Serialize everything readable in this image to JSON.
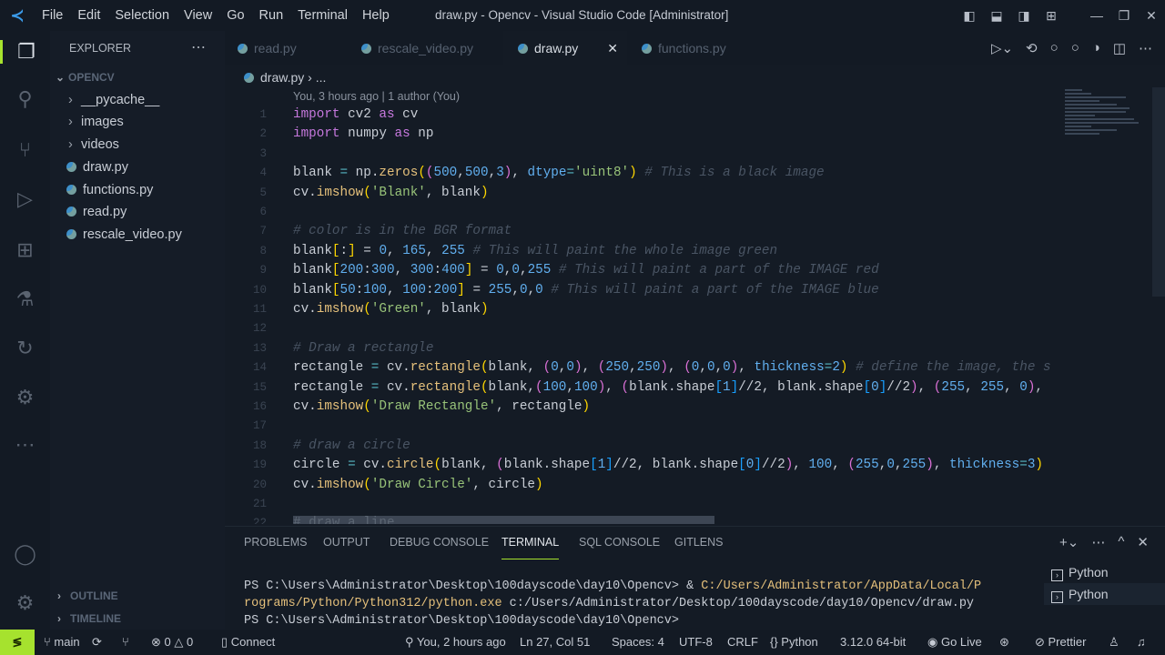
{
  "title_bar": {
    "menu": [
      "File",
      "Edit",
      "Selection",
      "View",
      "Go",
      "Run",
      "Terminal",
      "Help"
    ],
    "title": "draw.py - Opencv - Visual Studio Code [Administrator]"
  },
  "sidebar": {
    "title": "EXPLORER",
    "root": "OPENCV",
    "items": [
      {
        "label": "__pycache__",
        "type": "folder"
      },
      {
        "label": "images",
        "type": "folder"
      },
      {
        "label": "videos",
        "type": "folder"
      },
      {
        "label": "draw.py",
        "type": "file"
      },
      {
        "label": "functions.py",
        "type": "file"
      },
      {
        "label": "read.py",
        "type": "file"
      },
      {
        "label": "rescale_video.py",
        "type": "file"
      }
    ],
    "outline": "OUTLINE",
    "timeline": "TIMELINE"
  },
  "tabs": [
    {
      "label": "read.py"
    },
    {
      "label": "rescale_video.py"
    },
    {
      "label": "draw.py",
      "active": true
    },
    {
      "label": "functions.py"
    }
  ],
  "breadcrumb": {
    "file": "draw.py",
    "rest": "..."
  },
  "blame": "You, 3 hours ago | 1 author (You)",
  "code": [
    {
      "n": "1",
      "t": [
        [
          "import",
          "kw"
        ],
        [
          " cv2 ",
          ""
        ],
        [
          "as",
          "kw"
        ],
        [
          " cv",
          ""
        ]
      ]
    },
    {
      "n": "2",
      "t": [
        [
          "import",
          "kw"
        ],
        [
          " numpy ",
          ""
        ],
        [
          "as",
          "kw"
        ],
        [
          " np",
          ""
        ]
      ]
    },
    {
      "n": "3",
      "t": []
    },
    {
      "n": "4",
      "t": [
        [
          "blank ",
          ""
        ],
        [
          "=",
          "op"
        ],
        [
          " np.",
          ""
        ],
        [
          "zeros",
          "fn"
        ],
        [
          "(",
          "b1"
        ],
        [
          "(",
          "b2"
        ],
        [
          "500",
          "num"
        ],
        [
          ",",
          ""
        ],
        [
          "500",
          "num"
        ],
        [
          ",",
          ""
        ],
        [
          "3",
          "num"
        ],
        [
          ")",
          "b2"
        ],
        [
          ", ",
          ""
        ],
        [
          "dtype",
          "param"
        ],
        [
          "=",
          "op"
        ],
        [
          "'uint8'",
          "str"
        ],
        [
          ")",
          "b1"
        ],
        [
          " # This is a black image",
          "cm"
        ]
      ]
    },
    {
      "n": "5",
      "t": [
        [
          "cv.",
          ""
        ],
        [
          "imshow",
          "fn"
        ],
        [
          "(",
          "b1"
        ],
        [
          "'Blank'",
          "str"
        ],
        [
          ", blank",
          ""
        ],
        [
          ")",
          "b1"
        ]
      ]
    },
    {
      "n": "6",
      "t": []
    },
    {
      "n": "7",
      "t": [
        [
          "# color is in the BGR format",
          "cm"
        ]
      ]
    },
    {
      "n": "8",
      "t": [
        [
          "blank",
          ""
        ],
        [
          "[",
          "b1"
        ],
        [
          ":",
          ""
        ],
        [
          "]",
          "b1"
        ],
        [
          " = ",
          ""
        ],
        [
          "0",
          "num"
        ],
        [
          ", ",
          ""
        ],
        [
          "165",
          "num"
        ],
        [
          ", ",
          ""
        ],
        [
          "255",
          "num"
        ],
        [
          " # This will paint the whole image green",
          "cm"
        ]
      ]
    },
    {
      "n": "9",
      "t": [
        [
          "blank",
          ""
        ],
        [
          "[",
          "b1"
        ],
        [
          "200",
          "num"
        ],
        [
          ":",
          ""
        ],
        [
          "300",
          "num"
        ],
        [
          ", ",
          ""
        ],
        [
          "300",
          "num"
        ],
        [
          ":",
          ""
        ],
        [
          "400",
          "num"
        ],
        [
          "]",
          "b1"
        ],
        [
          " = ",
          ""
        ],
        [
          "0",
          "num"
        ],
        [
          ",",
          ""
        ],
        [
          "0",
          "num"
        ],
        [
          ",",
          ""
        ],
        [
          "255",
          "num"
        ],
        [
          " # This will paint a part of the IMAGE red",
          "cm"
        ]
      ]
    },
    {
      "n": "10",
      "t": [
        [
          "blank",
          ""
        ],
        [
          "[",
          "b1"
        ],
        [
          "50",
          "num"
        ],
        [
          ":",
          ""
        ],
        [
          "100",
          "num"
        ],
        [
          ", ",
          ""
        ],
        [
          "100",
          "num"
        ],
        [
          ":",
          ""
        ],
        [
          "200",
          "num"
        ],
        [
          "]",
          "b1"
        ],
        [
          " = ",
          ""
        ],
        [
          "255",
          "num"
        ],
        [
          ",",
          ""
        ],
        [
          "0",
          "num"
        ],
        [
          ",",
          ""
        ],
        [
          "0",
          "num"
        ],
        [
          " # This will paint a part of the IMAGE blue",
          "cm"
        ]
      ]
    },
    {
      "n": "11",
      "t": [
        [
          "cv.",
          ""
        ],
        [
          "imshow",
          "fn"
        ],
        [
          "(",
          "b1"
        ],
        [
          "'Green'",
          "str"
        ],
        [
          ", blank",
          ""
        ],
        [
          ")",
          "b1"
        ]
      ]
    },
    {
      "n": "12",
      "t": []
    },
    {
      "n": "13",
      "t": [
        [
          "# Draw a rectangle",
          "cm"
        ]
      ]
    },
    {
      "n": "14",
      "t": [
        [
          "rectangle ",
          ""
        ],
        [
          "=",
          "op"
        ],
        [
          " cv.",
          ""
        ],
        [
          "rectangle",
          "fn"
        ],
        [
          "(",
          "b1"
        ],
        [
          "blank, ",
          ""
        ],
        [
          "(",
          "b2"
        ],
        [
          "0",
          "num"
        ],
        [
          ",",
          ""
        ],
        [
          "0",
          "num"
        ],
        [
          ")",
          "b2"
        ],
        [
          ", ",
          ""
        ],
        [
          "(",
          "b2"
        ],
        [
          "250",
          "num"
        ],
        [
          ",",
          ""
        ],
        [
          "250",
          "num"
        ],
        [
          ")",
          "b2"
        ],
        [
          ", ",
          ""
        ],
        [
          "(",
          "b2"
        ],
        [
          "0",
          "num"
        ],
        [
          ",",
          ""
        ],
        [
          "0",
          "num"
        ],
        [
          ",",
          ""
        ],
        [
          "0",
          "num"
        ],
        [
          ")",
          "b2"
        ],
        [
          ", ",
          ""
        ],
        [
          "thickness",
          "param"
        ],
        [
          "=",
          "op"
        ],
        [
          "2",
          "num"
        ],
        [
          ")",
          "b1"
        ],
        [
          " # define the image, the s",
          "cm"
        ]
      ]
    },
    {
      "n": "15",
      "t": [
        [
          "rectangle ",
          ""
        ],
        [
          "=",
          "op"
        ],
        [
          " cv.",
          ""
        ],
        [
          "rectangle",
          "fn"
        ],
        [
          "(",
          "b1"
        ],
        [
          "blank,",
          ""
        ],
        [
          "(",
          "b2"
        ],
        [
          "100",
          "num"
        ],
        [
          ",",
          ""
        ],
        [
          "100",
          "num"
        ],
        [
          ")",
          "b2"
        ],
        [
          ", ",
          ""
        ],
        [
          "(",
          "b2"
        ],
        [
          "blank.shape",
          ""
        ],
        [
          "[",
          "b3"
        ],
        [
          "1",
          "num"
        ],
        [
          "]",
          "b3"
        ],
        [
          "//2, blank.shape",
          ""
        ],
        [
          "[",
          "b3"
        ],
        [
          "0",
          "num"
        ],
        [
          "]",
          "b3"
        ],
        [
          "//2",
          ""
        ],
        [
          ")",
          "b2"
        ],
        [
          ", ",
          ""
        ],
        [
          "(",
          "b2"
        ],
        [
          "255",
          "num"
        ],
        [
          ", ",
          ""
        ],
        [
          "255",
          "num"
        ],
        [
          ", ",
          ""
        ],
        [
          "0",
          "num"
        ],
        [
          ")",
          "b2"
        ],
        [
          ",",
          ""
        ]
      ]
    },
    {
      "n": "16",
      "t": [
        [
          "cv.",
          ""
        ],
        [
          "imshow",
          "fn"
        ],
        [
          "(",
          "b1"
        ],
        [
          "'Draw Rectangle'",
          "str"
        ],
        [
          ", rectangle",
          ""
        ],
        [
          ")",
          "b1"
        ]
      ]
    },
    {
      "n": "17",
      "t": []
    },
    {
      "n": "18",
      "t": [
        [
          "# draw a circle",
          "cm"
        ]
      ]
    },
    {
      "n": "19",
      "t": [
        [
          "circle ",
          ""
        ],
        [
          "=",
          "op"
        ],
        [
          " cv.",
          ""
        ],
        [
          "circle",
          "fn"
        ],
        [
          "(",
          "b1"
        ],
        [
          "blank, ",
          ""
        ],
        [
          "(",
          "b2"
        ],
        [
          "blank.shape",
          ""
        ],
        [
          "[",
          "b3"
        ],
        [
          "1",
          "num"
        ],
        [
          "]",
          "b3"
        ],
        [
          "//2, blank.shape",
          ""
        ],
        [
          "[",
          "b3"
        ],
        [
          "0",
          "num"
        ],
        [
          "]",
          "b3"
        ],
        [
          "//2",
          ""
        ],
        [
          ")",
          "b2"
        ],
        [
          ", ",
          ""
        ],
        [
          "100",
          "num"
        ],
        [
          ", ",
          ""
        ],
        [
          "(",
          "b2"
        ],
        [
          "255",
          "num"
        ],
        [
          ",",
          ""
        ],
        [
          "0",
          "num"
        ],
        [
          ",",
          ""
        ],
        [
          "255",
          "num"
        ],
        [
          ")",
          "b2"
        ],
        [
          ", ",
          ""
        ],
        [
          "thickness",
          "param"
        ],
        [
          "=",
          "op"
        ],
        [
          "3",
          "num"
        ],
        [
          ")",
          "b1"
        ]
      ]
    },
    {
      "n": "20",
      "t": [
        [
          "cv.",
          ""
        ],
        [
          "imshow",
          "fn"
        ],
        [
          "(",
          "b1"
        ],
        [
          "'Draw Circle'",
          "str"
        ],
        [
          ", circle",
          ""
        ],
        [
          ")",
          "b1"
        ]
      ]
    },
    {
      "n": "21",
      "t": []
    },
    {
      "n": "22",
      "t": [
        [
          "# draw a line                                         ",
          "hl"
        ]
      ]
    }
  ],
  "panel": {
    "tabs": [
      "PROBLEMS",
      "OUTPUT",
      "DEBUG CONSOLE",
      "TERMINAL",
      "SQL CONSOLE",
      "GITLENS"
    ],
    "active": "TERMINAL",
    "terminal": {
      "l1a": "PS C:\\Users\\Administrator\\Desktop\\100dayscode\\day10\\Opencv> & ",
      "l1b": "C:/Users/Administrator/AppData/Local/P",
      "l2a": "rograms/Python/Python312/python.exe",
      "l2b": " c:/Users/Administrator/Desktop/100dayscode/day10/Opencv/draw.py",
      "l3": "PS C:\\Users\\Administrator\\Desktop\\100dayscode\\day10\\Opencv>"
    },
    "terminals": [
      "Python",
      "Python"
    ]
  },
  "status": {
    "branch": "main",
    "errors": "0",
    "warnings": "0",
    "connect": "Connect",
    "blame": "You, 2 hours ago",
    "position": "Ln 27, Col 51",
    "spaces": "Spaces: 4",
    "encoding": "UTF-8",
    "eol": "CRLF",
    "language": "Python",
    "interpreter": "3.12.0 64-bit",
    "golive": "Go Live",
    "prettier": "Prettier"
  }
}
